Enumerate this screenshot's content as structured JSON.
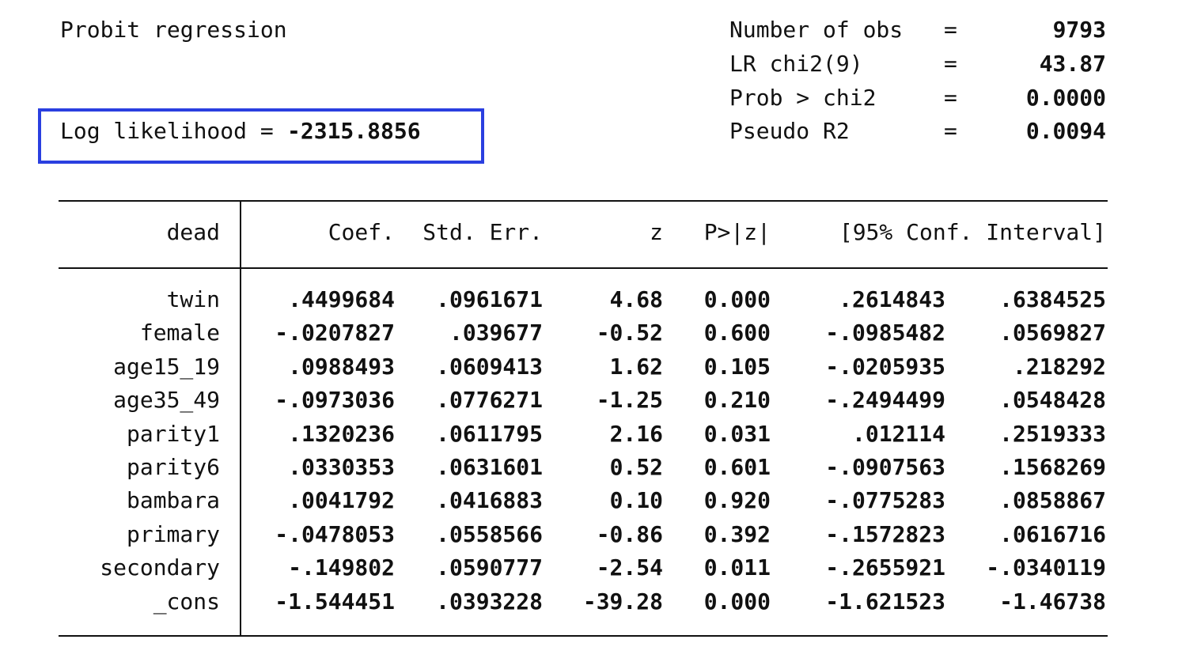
{
  "header": {
    "title": "Probit regression",
    "stats": [
      {
        "label": "Number of obs",
        "eq": "=",
        "value": "9793"
      },
      {
        "label": "LR chi2(9)",
        "eq": "=",
        "value": "43.87"
      },
      {
        "label": "Prob > chi2",
        "eq": "=",
        "value": "0.0000"
      },
      {
        "label": "Pseudo R2",
        "eq": "=",
        "value": "0.0094"
      }
    ],
    "log_likelihood": {
      "label": "Log likelihood = ",
      "value": "-2315.8856",
      "highlight_color": "#2a3fe0"
    }
  },
  "table": {
    "columns": [
      "dead",
      "Coef.",
      "Std. Err.",
      "z",
      "P>|z|",
      "[95% Conf. Interval]"
    ],
    "rows": [
      {
        "var": "twin",
        "coef": ".4499684",
        "se": ".0961671",
        "z": "4.68",
        "p": "0.000",
        "lo": ".2614843",
        "hi": ".6384525"
      },
      {
        "var": "female",
        "coef": "-.0207827",
        "se": ".039677",
        "z": "-0.52",
        "p": "0.600",
        "lo": "-.0985482",
        "hi": ".0569827"
      },
      {
        "var": "age15_19",
        "coef": ".0988493",
        "se": ".0609413",
        "z": "1.62",
        "p": "0.105",
        "lo": "-.0205935",
        "hi": ".218292"
      },
      {
        "var": "age35_49",
        "coef": "-.0973036",
        "se": ".0776271",
        "z": "-1.25",
        "p": "0.210",
        "lo": "-.2494499",
        "hi": ".0548428"
      },
      {
        "var": "parity1",
        "coef": ".1320236",
        "se": ".0611795",
        "z": "2.16",
        "p": "0.031",
        "lo": ".012114",
        "hi": ".2519333"
      },
      {
        "var": "parity6",
        "coef": ".0330353",
        "se": ".0631601",
        "z": "0.52",
        "p": "0.601",
        "lo": "-.0907563",
        "hi": ".1568269"
      },
      {
        "var": "bambara",
        "coef": ".0041792",
        "se": ".0416883",
        "z": "0.10",
        "p": "0.920",
        "lo": "-.0775283",
        "hi": ".0858867"
      },
      {
        "var": "primary",
        "coef": "-.0478053",
        "se": ".0558566",
        "z": "-0.86",
        "p": "0.392",
        "lo": "-.1572823",
        "hi": ".0616716"
      },
      {
        "var": "secondary",
        "coef": "-.149802",
        "se": ".0590777",
        "z": "-2.54",
        "p": "0.011",
        "lo": "-.2655921",
        "hi": "-.0340119"
      },
      {
        "var": "_cons",
        "coef": "-1.544451",
        "se": ".0393228",
        "z": "-39.28",
        "p": "0.000",
        "lo": "-1.621523",
        "hi": "-1.46738"
      }
    ]
  }
}
